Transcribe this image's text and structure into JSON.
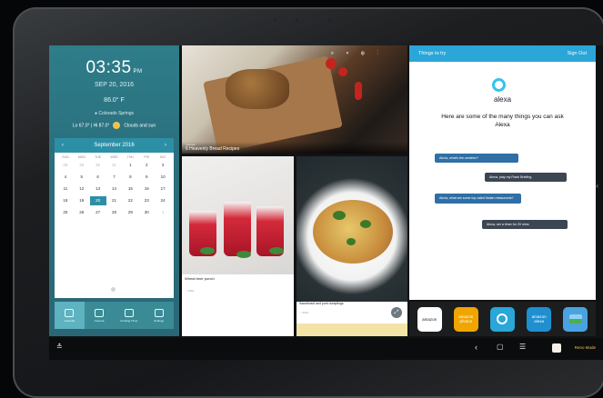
{
  "clock": {
    "time": "03:35",
    "ampm": "PM",
    "date": "SEP 20, 2016",
    "temperature": "86.0° F",
    "location": "Colorado Springs",
    "hi_lo": "Lo 67.0° | Hi 87.0°",
    "condition": "Clouds and sun"
  },
  "calendar": {
    "month_label": "September 2016",
    "prev_icon": "‹",
    "next_icon": "›",
    "dow": [
      "SUN",
      "MON",
      "TUE",
      "WED",
      "THU",
      "FRI",
      "SAT"
    ],
    "weeks": [
      [
        "28",
        "29",
        "30",
        "31",
        "1",
        "2",
        "3"
      ],
      [
        "4",
        "5",
        "6",
        "7",
        "8",
        "9",
        "10"
      ],
      [
        "11",
        "12",
        "13",
        "14",
        "15",
        "16",
        "17"
      ],
      [
        "18",
        "19",
        "20",
        "21",
        "22",
        "23",
        "24"
      ],
      [
        "25",
        "26",
        "27",
        "28",
        "29",
        "30",
        "1"
      ]
    ],
    "muted_first_row": 4,
    "today": "20"
  },
  "left_nav": [
    {
      "label": "Calendar",
      "icon": "calendar-icon",
      "active": true
    },
    {
      "label": "Camera",
      "icon": "camera-icon",
      "active": false
    },
    {
      "label": "Cooking Timer",
      "icon": "timer-icon",
      "active": false
    },
    {
      "label": "Settings",
      "icon": "gear-icon",
      "active": false
    }
  ],
  "tiles": {
    "bread": {
      "source": "Collection",
      "title": "6 Heavenly Bread Recipes"
    },
    "punch": {
      "title": "Wheat beer punch",
      "meta": "2016"
    },
    "dumplings": {
      "title": "Sauerkraut and pork dumplings",
      "meta": "2016"
    }
  },
  "alexa": {
    "header_left": "Things to try",
    "header_right": "Sign Out",
    "wordmark": "alexa",
    "intro": "Here are some of the many things you can ask Alexa",
    "bubbles": [
      "Alexa, what's the weather?",
      "Alexa, play my Flash Briefing",
      "Alexa, what are some top-rated Italian restaurants?",
      "Alexa, set a timer for 20 mins"
    ]
  },
  "dock": [
    {
      "label": "amazon",
      "icon": "amazon-icon",
      "color": "#ffffff"
    },
    {
      "label": "amazon photos",
      "icon": "amazon-photos-icon",
      "color": "#f0a500"
    },
    {
      "label": "",
      "icon": "alexa-icon",
      "color": "#2aa6d8"
    },
    {
      "label": "amazon alexa",
      "icon": "amazon-alexa-app-icon",
      "color": "#1f8fcf"
    },
    {
      "label": "",
      "icon": "gallery-icon",
      "color": "#4aa3e0"
    }
  ],
  "sysbar": {
    "reno_label": "Reno Mode"
  }
}
